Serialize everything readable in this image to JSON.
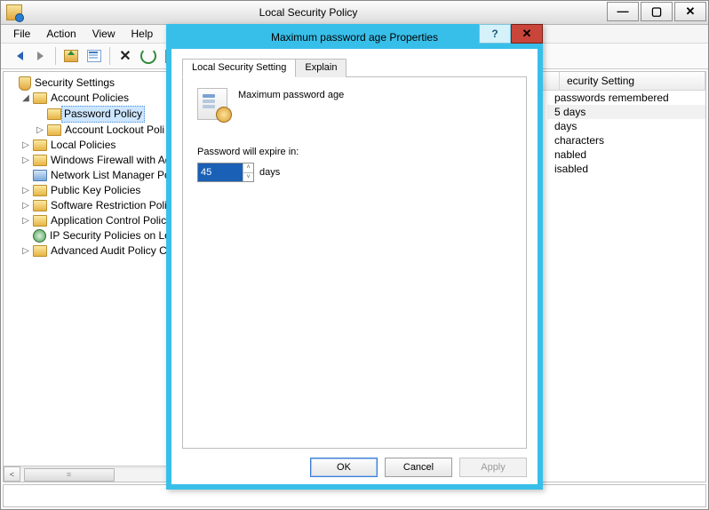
{
  "window": {
    "title": "Local Security Policy"
  },
  "menu": {
    "file": "File",
    "action": "Action",
    "view": "View",
    "help": "Help"
  },
  "tree": {
    "root": "Security Settings",
    "account_policies": "Account Policies",
    "password_policy": "Password Policy",
    "account_lockout": "Account Lockout Poli",
    "local_policies": "Local Policies",
    "firewall": "Windows Firewall with Ad",
    "network_list": "Network List Manager Po",
    "public_key": "Public Key Policies",
    "software_restriction": "Software Restriction Polic",
    "app_control": "Application Control Polic",
    "ipsec": "IP Security Policies on Lo",
    "advanced_audit": "Advanced Audit Policy C"
  },
  "detail": {
    "col_setting": "ecurity Setting",
    "rows": [
      " passwords remembered",
      "5 days",
      " days",
      " characters",
      "nabled",
      "isabled"
    ]
  },
  "dialog": {
    "title": "Maximum password age Properties",
    "tab_setting": "Local Security Setting",
    "tab_explain": "Explain",
    "heading": "Maximum password age",
    "field_label": "Password will expire in:",
    "value": "45",
    "unit": "days",
    "ok": "OK",
    "cancel": "Cancel",
    "apply": "Apply"
  }
}
